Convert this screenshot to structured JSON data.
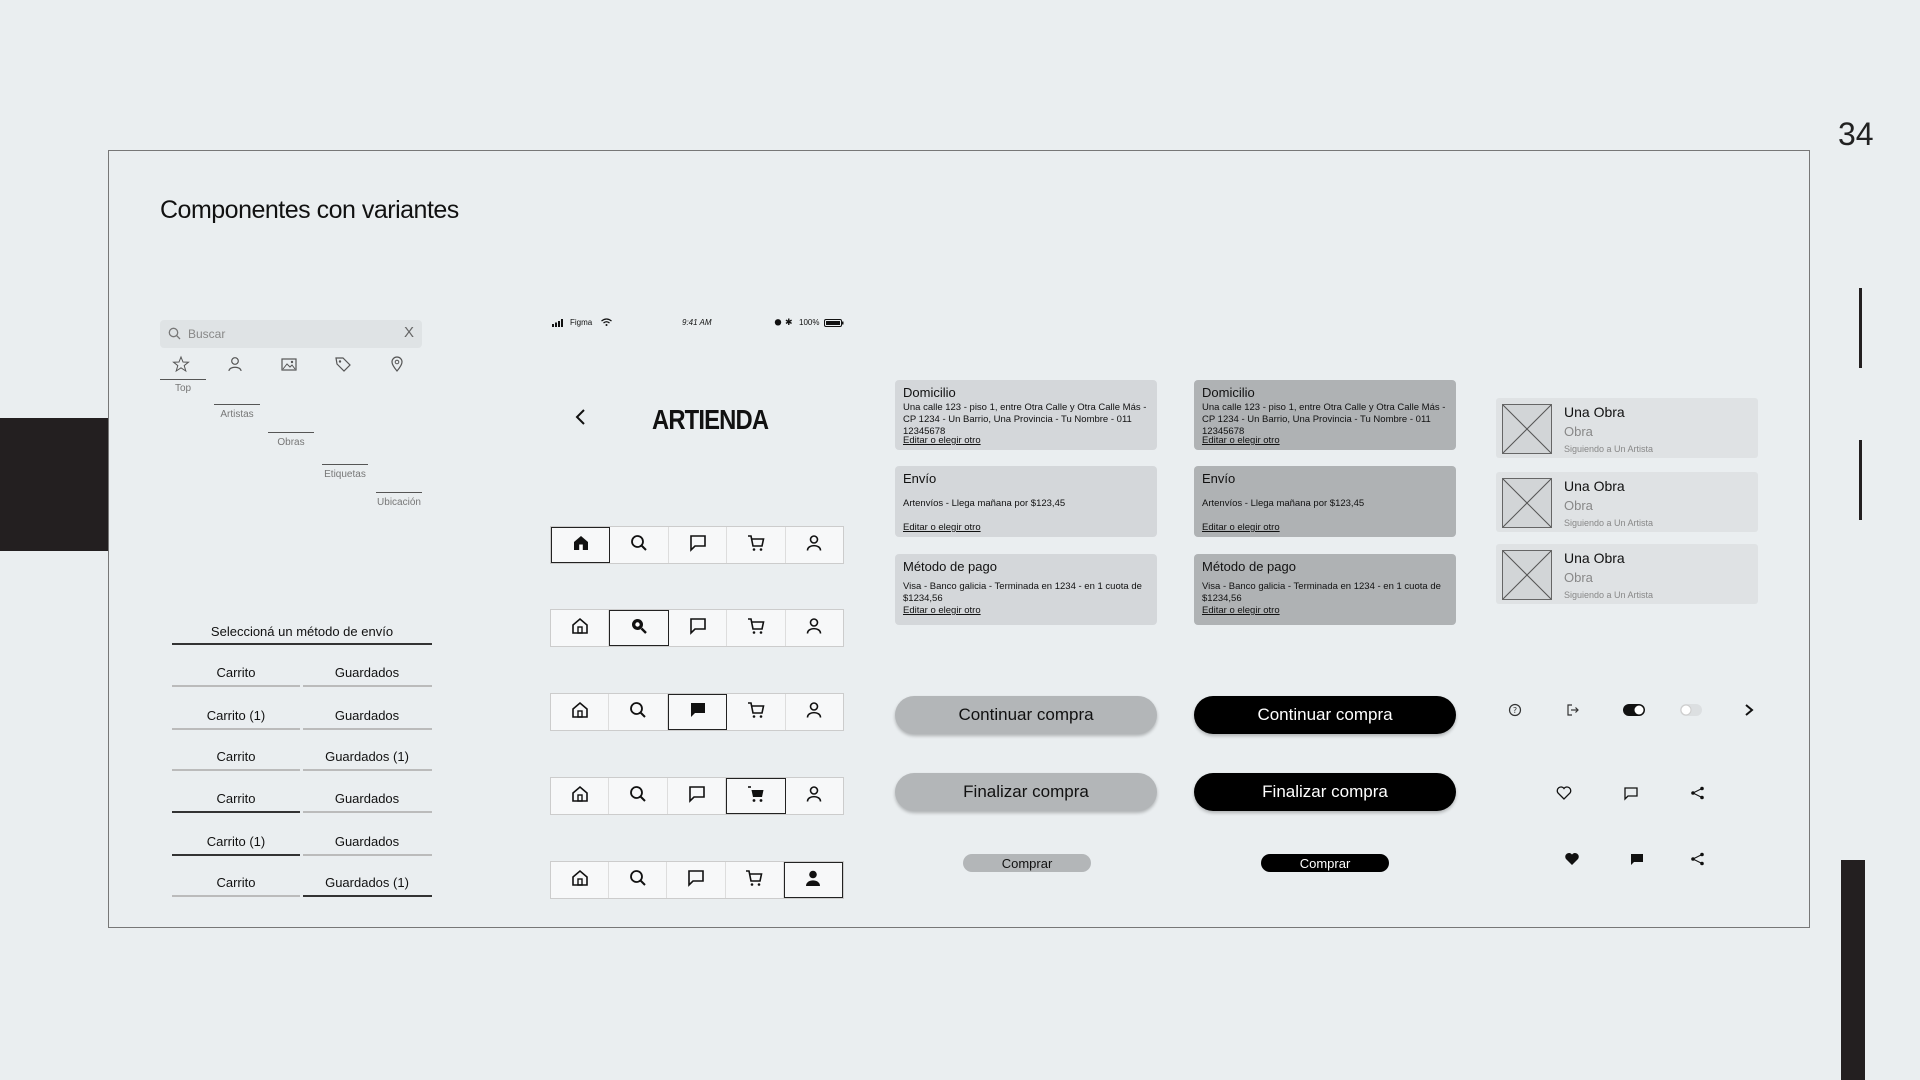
{
  "page_number": "34",
  "title": "Componentes con variantes",
  "search": {
    "placeholder": "Buscar",
    "clear": "X"
  },
  "filters": {
    "labels": [
      "Top",
      "Artistas",
      "Obras",
      "Etiquetas",
      "Ubicación"
    ]
  },
  "shipping": {
    "title": "Seleccioná un método de envío",
    "rows": [
      [
        "Carrito",
        "Guardados"
      ],
      [
        "Carrito (1)",
        "Guardados"
      ],
      [
        "Carrito",
        "Guardados (1)"
      ],
      [
        "Carrito",
        "Guardados"
      ],
      [
        "Carrito (1)",
        "Guardados"
      ],
      [
        "Carrito",
        "Guardados (1)"
      ]
    ]
  },
  "phone": {
    "carrier": "Figma",
    "time": "9:41 AM",
    "battery": "100%",
    "logo": "ARTIENDA"
  },
  "cards": {
    "domicilio": {
      "title": "Domicilio",
      "body": "Una calle 123 - piso 1, entre Otra Calle y Otra Calle Más - CP 1234 - Un Barrio, Una Provincia - Tu Nombre - 011 12345678",
      "link": "Editar o elegir otro"
    },
    "envio": {
      "title": "Envío",
      "body": "Artenvíos - Llega mañana por $123,45",
      "link": "Editar o elegir otro"
    },
    "pago": {
      "title": "Método de pago",
      "body": "Visa - Banco galicia - Terminada en 1234 - en 1 cuota de $1234,56",
      "link": "Editar o elegir otro"
    }
  },
  "buttons": {
    "continuar": "Continuar compra",
    "finalizar": "Finalizar compra",
    "comprar": "Comprar"
  },
  "artworks": [
    {
      "title": "Una Obra",
      "subtitle": "Obra",
      "meta": "Siguiendo a Un Artista"
    },
    {
      "title": "Una Obra",
      "subtitle": "Obra",
      "meta": "Siguiendo a Un Artista"
    },
    {
      "title": "Una Obra",
      "subtitle": "Obra",
      "meta": "Siguiendo a Un Artista"
    }
  ],
  "colors": {
    "background": "#eaeef0",
    "accent_dark": "#231f20",
    "card_light": "#d4d7da",
    "card_dark": "#afb2b4"
  }
}
